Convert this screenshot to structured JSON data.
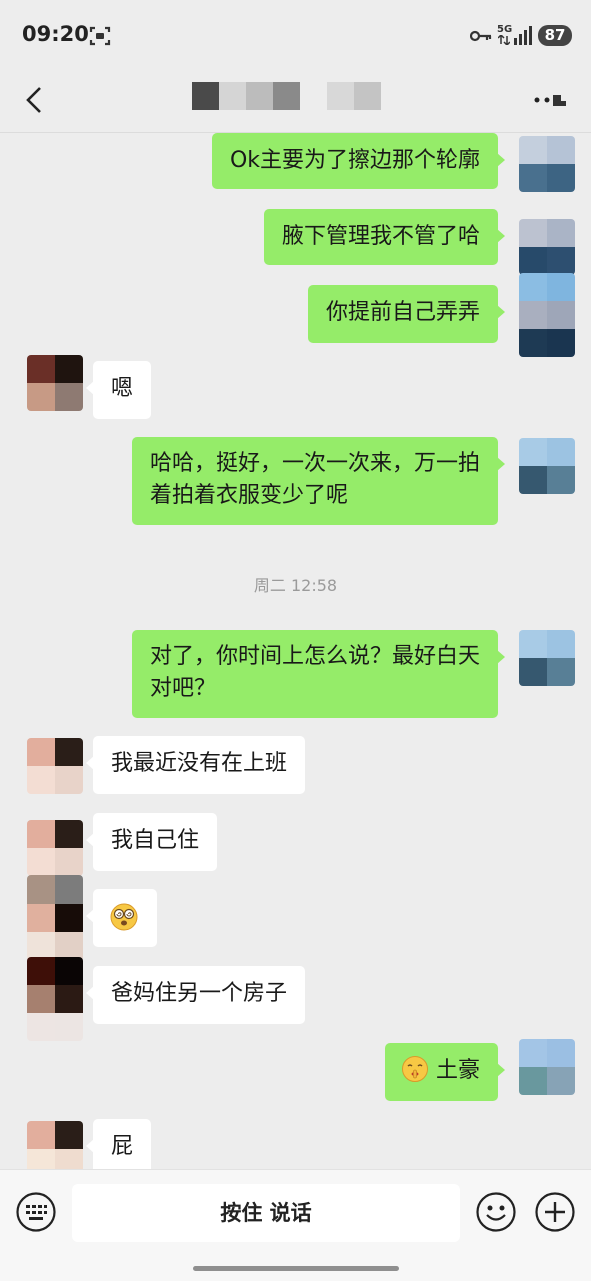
{
  "status_bar": {
    "time": "09:20",
    "network": "5G",
    "battery": "87",
    "icons": [
      "screenshot-icon",
      "key-icon",
      "signal-icon",
      "battery-icon"
    ]
  },
  "header": {
    "back_icon": "chevron-left-icon",
    "more_icon": "more-icon"
  },
  "messages": [
    {
      "side": "me",
      "text": "Ok主要为了擦边那个轮廓"
    },
    {
      "side": "me",
      "text": "腋下管理我不管了哈"
    },
    {
      "side": "me",
      "text": "你提前自己弄弄"
    },
    {
      "side": "other",
      "text": "嗯"
    },
    {
      "side": "me",
      "lines": [
        "哈哈，挺好，一次一次来，万一拍",
        "着拍着衣服变少了呢"
      ]
    },
    {
      "side": "time",
      "text": "周二 12:58"
    },
    {
      "side": "me",
      "lines": [
        "对了，你时间上怎么说？最好白天",
        "对吧？"
      ]
    },
    {
      "side": "other",
      "text": "我最近没有在上班"
    },
    {
      "side": "other",
      "text": "我自己住"
    },
    {
      "side": "other",
      "emoji": "dizzy-face-emoji"
    },
    {
      "side": "other",
      "text": "爸妈住另一个房子"
    },
    {
      "side": "me",
      "emoji": "shushing-face-emoji",
      "text": "土豪"
    },
    {
      "side": "other",
      "text": "屁"
    }
  ],
  "input_bar": {
    "voice_label": "按住 说话",
    "keyboard_icon": "keyboard-icon",
    "emoji_icon": "smiley-icon",
    "plus_icon": "plus-icon"
  },
  "colors": {
    "background": "#ededed",
    "my_bubble": "#95ec69",
    "their_bubble": "#ffffff"
  }
}
